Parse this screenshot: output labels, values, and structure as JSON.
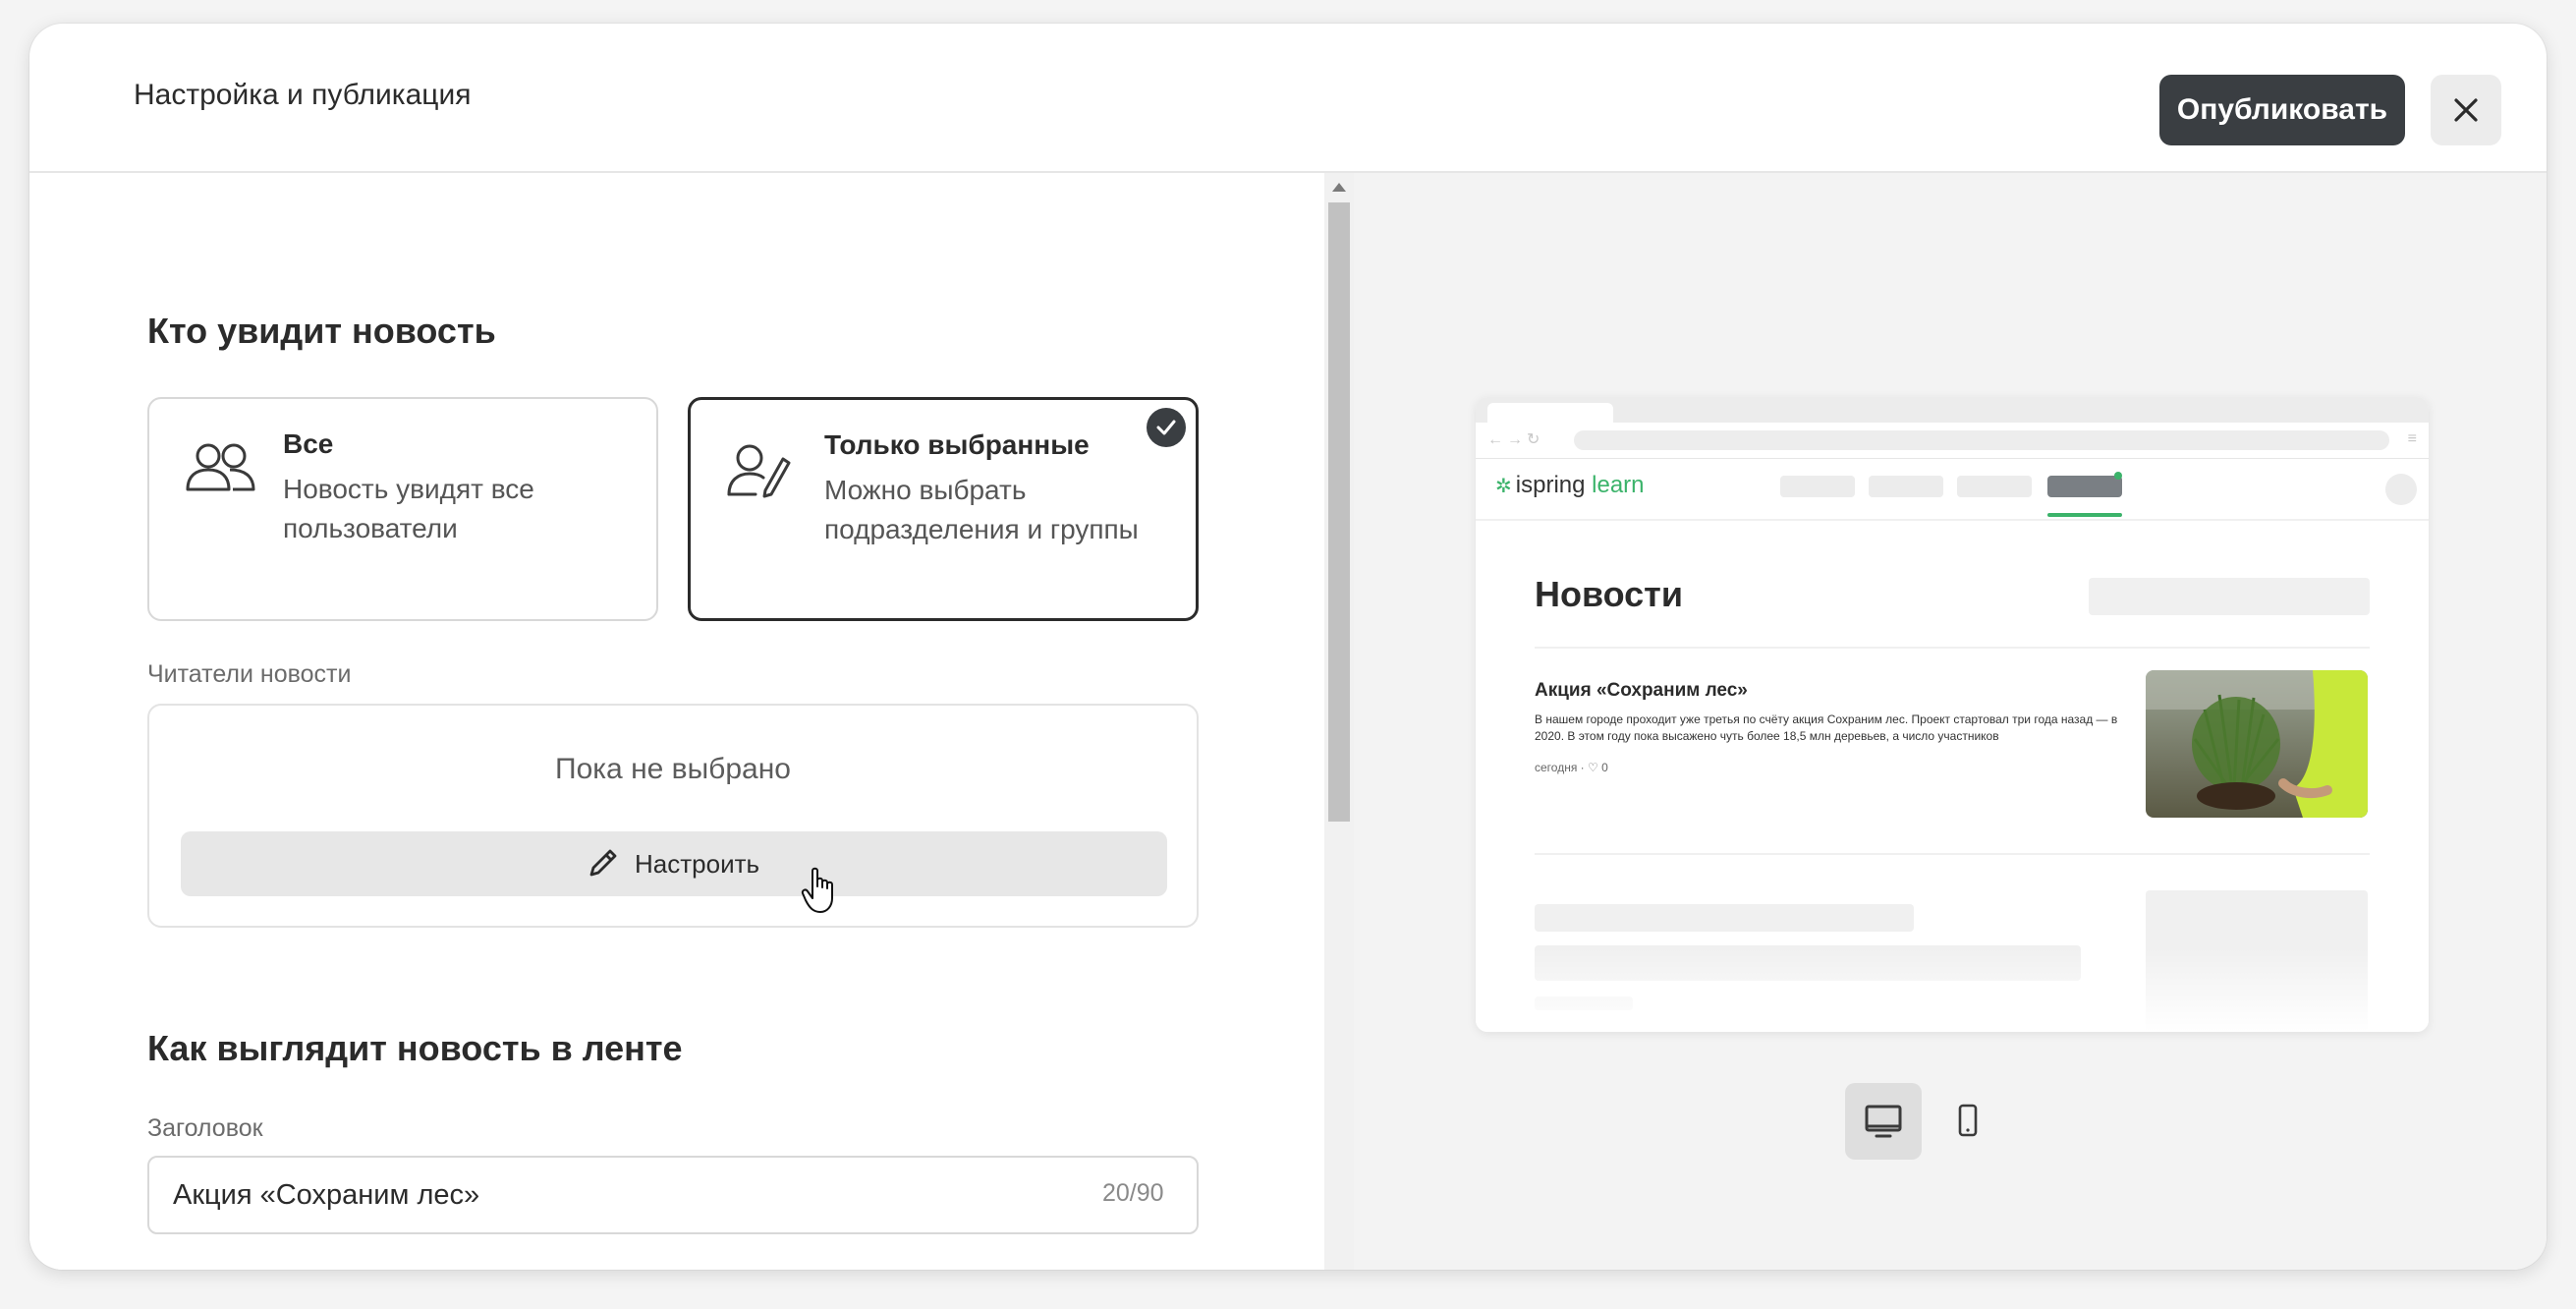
{
  "dialog": {
    "title": "Настройка и публикация",
    "publish_label": "Опубликовать"
  },
  "audience": {
    "section_title": "Кто увидит новость",
    "options": [
      {
        "title": "Все",
        "description": "Новость увидят все пользователи",
        "icon": "users-icon",
        "selected": false
      },
      {
        "title": "Только выбранные",
        "description": "Можно выбрать подразделения и группы",
        "icon": "user-edit-icon",
        "selected": true
      }
    ],
    "readers_label": "Читатели новости",
    "readers_empty": "Пока не выбрано",
    "configure_label": "Настроить"
  },
  "feed": {
    "section_title": "Как выглядит новость в ленте",
    "title_label": "Заголовок",
    "title_value": "Акция «Сохраним лес»",
    "title_counter": "20/90"
  },
  "preview": {
    "logo_main": "ispring",
    "logo_accent": "learn",
    "page_title": "Новости",
    "post": {
      "title": "Акция «Сохраним лес»",
      "text": "В нашем городе проходит уже третья по счёту акция Сохраним лес. Проект стартовал три года назад — в 2020. В этом году пока высажено чуть более 18,5 млн деревьев, а число участников",
      "meta": "сегодня · ♡ 0"
    },
    "device_modes": [
      "desktop-icon",
      "mobile-icon"
    ],
    "active_device": "desktop"
  },
  "colors": {
    "accent": "#3bb36a",
    "primary_button": "#3a3e42"
  }
}
